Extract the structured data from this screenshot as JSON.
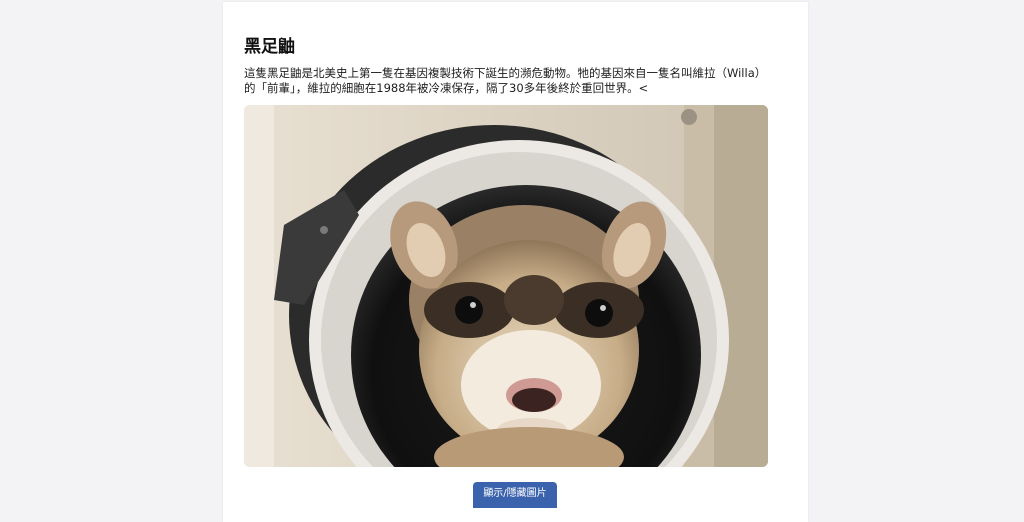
{
  "article": {
    "title": "黑足鼬",
    "description": "這隻黑足鼬是北美史上第一隻在基因複製技術下誕生的瀕危動物。牠的基因來自一隻名叫維拉（Willa）的「前輩」，維拉的細胞在1988年被冷凍保存，隔了30多年後終於重回世界。<",
    "image_alt": "black-footed ferret peeking out of a white pipe"
  },
  "toggle_button": {
    "label": "顯示/隱藏圖片"
  },
  "colors": {
    "page_background": "#f3f3f6",
    "card_background": "#ffffff",
    "button_background": "#3b63ad"
  }
}
